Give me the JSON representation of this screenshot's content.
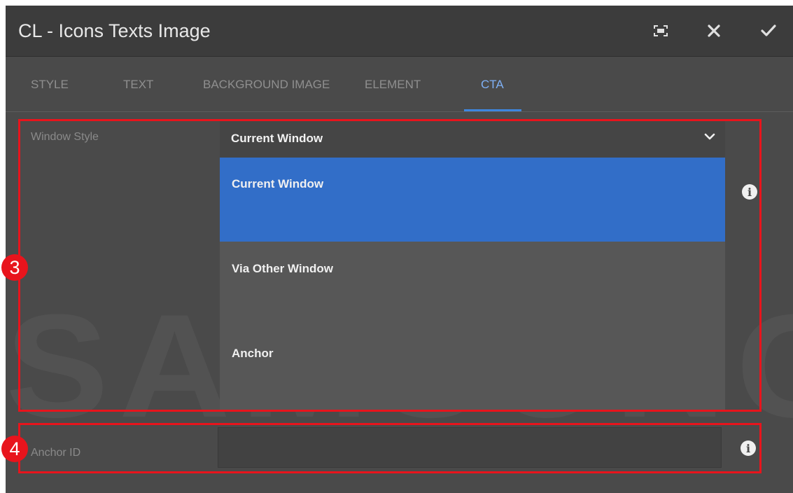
{
  "dialog": {
    "title": "CL - Icons Texts Image",
    "controls": [
      "fullscreen-icon",
      "close-icon",
      "check-icon"
    ]
  },
  "tabs": [
    {
      "label": "STYLE",
      "active": false
    },
    {
      "label": "TEXT",
      "active": false
    },
    {
      "label": "BACKGROUND IMAGE",
      "active": false
    },
    {
      "label": "ELEMENT",
      "active": false
    },
    {
      "label": "CTA",
      "active": true
    }
  ],
  "window_style": {
    "label": "Window Style",
    "selected": "Current Window",
    "options": [
      {
        "label": "Current Window",
        "selected": true
      },
      {
        "label": "Via Other Window",
        "selected": false
      },
      {
        "label": "Anchor",
        "selected": false
      }
    ]
  },
  "anchor_id": {
    "label": "Anchor ID",
    "value": ""
  },
  "watermark": "SAMSUNG",
  "annotations": [
    "3",
    "4"
  ],
  "colors": {
    "accent": "#326ec8",
    "tab_active": "#7fb0f5",
    "highlight": "#e8141c"
  }
}
